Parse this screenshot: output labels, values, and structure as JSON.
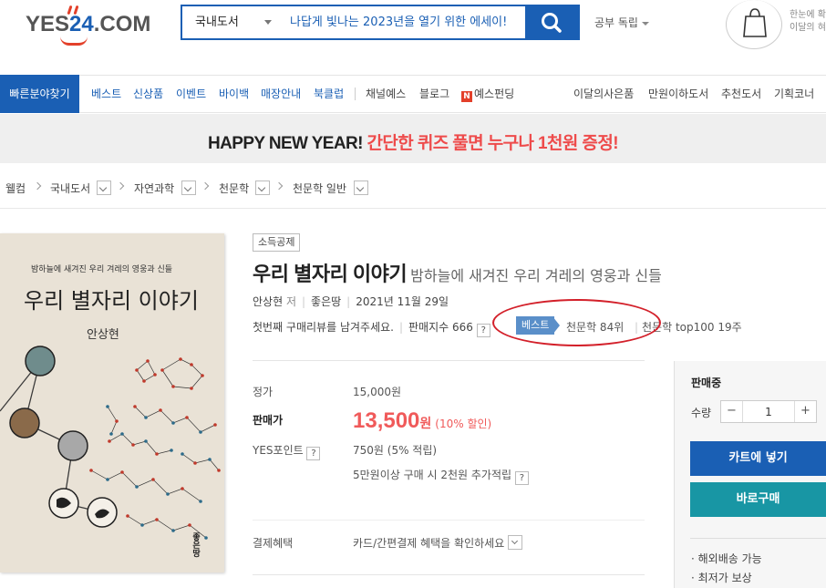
{
  "header": {
    "logo_text_1": "YES",
    "logo_text_2": "24",
    "logo_text_3": ".COM",
    "search_category": "국내도서",
    "search_placeholder": "나답게 빛나는 2023년을 열기 위한 에세이!",
    "study_label": "공부 독립",
    "month_text_1": "한눈에 확",
    "month_text_2": "이달의 혀"
  },
  "nav": {
    "quick_label": "빠른분야찾기",
    "items_blue": [
      "베스트",
      "신상품",
      "이벤트",
      "바이백",
      "매장안내",
      "북클럽"
    ],
    "items_gray": [
      "채널예스",
      "블로그",
      "예스펀딩"
    ],
    "n_badge": "N",
    "items_right": [
      "이달의사은품",
      "만원이하도서",
      "추천도서",
      "기획코너"
    ]
  },
  "banner": {
    "text_black": "HAPPY NEW YEAR!",
    "text_red": "간단한 퀴즈 풀면 누구나 1천원 증정!"
  },
  "breadcrumb": [
    "웰컴",
    "국내도서",
    "자연과학",
    "천문학",
    "천문학 일반"
  ],
  "book": {
    "cover_subtitle": "밤하늘에 새겨진 우리 겨레의 영웅과 신들",
    "cover_title": "우리 별자리 이야기",
    "cover_author": "안상현",
    "cover_publisher": "좋은땅",
    "tax_badge": "소득공제",
    "title": "우리 별자리 이야기",
    "subtitle": "밤하늘에 새겨진 우리 겨레의 영웅과 신들",
    "author": "안상현",
    "author_role": "저",
    "publisher": "좋은땅",
    "date": "2021년 11월 29일",
    "review_prompt": "첫번째 구매리뷰를 남겨주세요.",
    "sales_index": "판매지수 666",
    "best_badge": "베스트",
    "rank_1": "천문학 84위",
    "rank_2": "천문학 top100 19주"
  },
  "price": {
    "list_label": "정가",
    "list_value": "15,000원",
    "sale_label": "판매가",
    "sale_value": "13,500",
    "sale_unit": "원",
    "discount": "(10% 할인)",
    "point_label": "YES포인트",
    "point_value": "750원 (5% 적립)",
    "point_extra": "5만원이상 구매 시 2천원 추가적립",
    "benefit_label": "결제혜택",
    "benefit_value": "카드/간편결제 혜택을 확인하세요"
  },
  "panel": {
    "status": "판매중",
    "qty_label": "수량",
    "qty_value": "1",
    "minus": "−",
    "plus": "+",
    "cart_label": "카트에 넣기",
    "buy_label": "바로구매",
    "note_1": "· 해외배송 가능",
    "note_2": "· 최저가 보상"
  },
  "colors": {
    "brand_blue": "#1a5fb4",
    "price_red": "#f05a5a",
    "buy_teal": "#1896a4",
    "highlight_oval": "#d3202a"
  },
  "icons": [
    "search-icon",
    "shopping-bag-icon",
    "chevron-down-icon",
    "chevron-right-icon",
    "question-icon"
  ]
}
